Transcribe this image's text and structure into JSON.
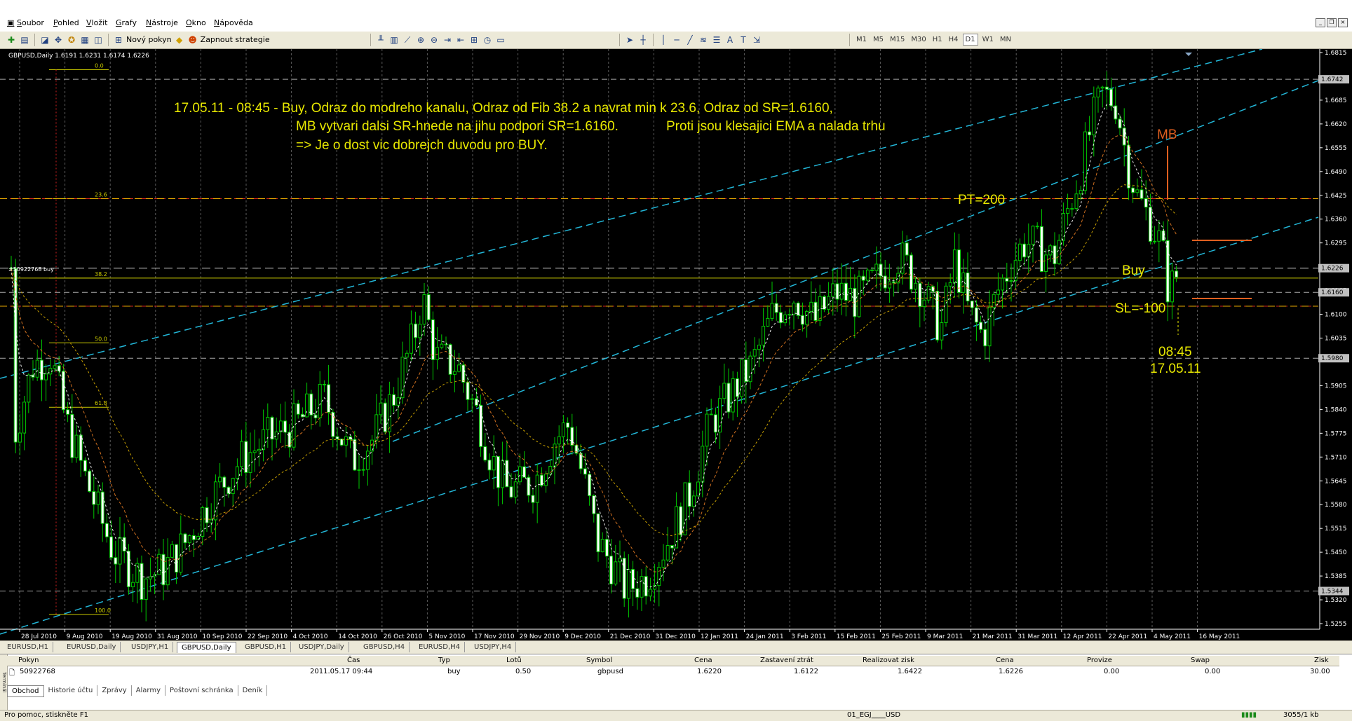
{
  "menu": [
    "Soubor",
    "Pohled",
    "Vložit",
    "Grafy",
    "Nástroje",
    "Okno",
    "Nápověda"
  ],
  "toolbar": {
    "new_order": "Nový pokyn",
    "strategies": "Zapnout strategie",
    "timeframes": [
      "M1",
      "M5",
      "M15",
      "M30",
      "H1",
      "H4",
      "D1",
      "W1",
      "MN"
    ],
    "active_timeframe": "D1"
  },
  "chart": {
    "header": "GBPUSD,Daily  1.6191 1.6231 1.6174 1.6226",
    "order_label": "#50922768 buy",
    "fib_levels": [
      {
        "label": "0.0",
        "price": 1.6768
      },
      {
        "label": "23.6",
        "price": 1.6416
      },
      {
        "label": "38.2",
        "price": 1.6199
      },
      {
        "label": "50.0",
        "price": 1.6022
      },
      {
        "label": "61.8",
        "price": 1.5846
      },
      {
        "label": "100.0",
        "price": 1.528
      }
    ],
    "annotation_lines": [
      "17.05.11 - 08:45 - Buy, Odraz do modreho kanalu, Odraz od Fib  38.2 a navrat min k 23.6, Odraz od SR=1.6160,",
      "MB vytvari dalsi SR-hnede na jihu podpori SR=1.6160.",
      "Proti jsou klesajici EMA a nalada trhu",
      "=>  Je o dost vic dobrejch duvodu pro BUY."
    ],
    "labels": {
      "mb": "MB",
      "pt": "PT=200",
      "buy": "Buy",
      "sl": "SL=-100",
      "time": "08:45",
      "date": "17.05.11"
    },
    "price_ticks": [
      "1.6815",
      "1.6685",
      "1.6620",
      "1.6555",
      "1.6490",
      "1.6425",
      "1.6360",
      "1.6295",
      "1.6165",
      "1.6100",
      "1.6035",
      "1.5905",
      "1.5840",
      "1.5775",
      "1.5710",
      "1.5645",
      "1.5580",
      "1.5515",
      "1.5450",
      "1.5385",
      "1.5320",
      "1.5255"
    ],
    "price_markers": [
      {
        "text": "1.6742",
        "price": 1.6742
      },
      {
        "text": "1.6226",
        "price": 1.6226
      },
      {
        "text": "1.6160",
        "price": 1.616
      },
      {
        "text": "1.5980",
        "price": 1.598
      },
      {
        "text": "1.5344",
        "price": 1.5344
      }
    ],
    "date_ticks": [
      "28 Jul 2010",
      "9 Aug 2010",
      "19 Aug 2010",
      "31 Aug 2010",
      "10 Sep 2010",
      "22 Sep 2010",
      "4 Oct 2010",
      "14 Oct 2010",
      "26 Oct 2010",
      "5 Nov 2010",
      "17 Nov 2010",
      "29 Nov 2010",
      "9 Dec 2010",
      "21 Dec 2010",
      "31 Dec 2010",
      "12 Jan 2011",
      "24 Jan 2011",
      "3 Feb 2011",
      "15 Feb 2011",
      "25 Feb 2011",
      "9 Mar 2011",
      "21 Mar 2011",
      "31 Mar 2011",
      "12 Apr 2011",
      "22 Apr 2011",
      "4 May 2011",
      "16 May 2011"
    ],
    "colors": {
      "bg": "#000000",
      "candle": "#00c800",
      "channel": "#22b5d6",
      "fib": "#c8c800",
      "sr_red": "#d02020",
      "annotation": "#e8e800",
      "mb": "#e06020",
      "grid": "#5a5a5a"
    }
  },
  "chart_tabs": [
    "EURUSD,H1",
    "EURUSD,Daily",
    "USDJPY,H1",
    "GBPUSD,Daily",
    "GBPUSD,H1",
    "USDJPY,Daily",
    "GBPUSD,H4",
    "EURUSD,H4",
    "USDJPY,H4"
  ],
  "active_chart_tab": "GBPUSD,Daily",
  "terminal": {
    "columns": [
      "Pokyn",
      "Čas",
      "Typ",
      "Lotů",
      "Symbol",
      "Cena",
      "Zastavení ztrát",
      "Realizovat zisk",
      "Cena",
      "Provize",
      "Swap",
      "Zisk"
    ],
    "row": [
      "50922768",
      "2011.05.17 09:44",
      "buy",
      "0.50",
      "gbpusd",
      "1.6220",
      "1.6122",
      "1.6422",
      "1.6226",
      "0.00",
      "0.00",
      "30.00"
    ],
    "tabs": [
      "Obchod",
      "Historie účtu",
      "Zprávy",
      "Alarmy",
      "Poštovní schránka",
      "Deník"
    ],
    "side_label": "Terminál"
  },
  "status": {
    "help": "Pro pomoc, stiskněte F1",
    "profile": "01_EGJ____USD",
    "traffic": "3055/1 kb"
  }
}
